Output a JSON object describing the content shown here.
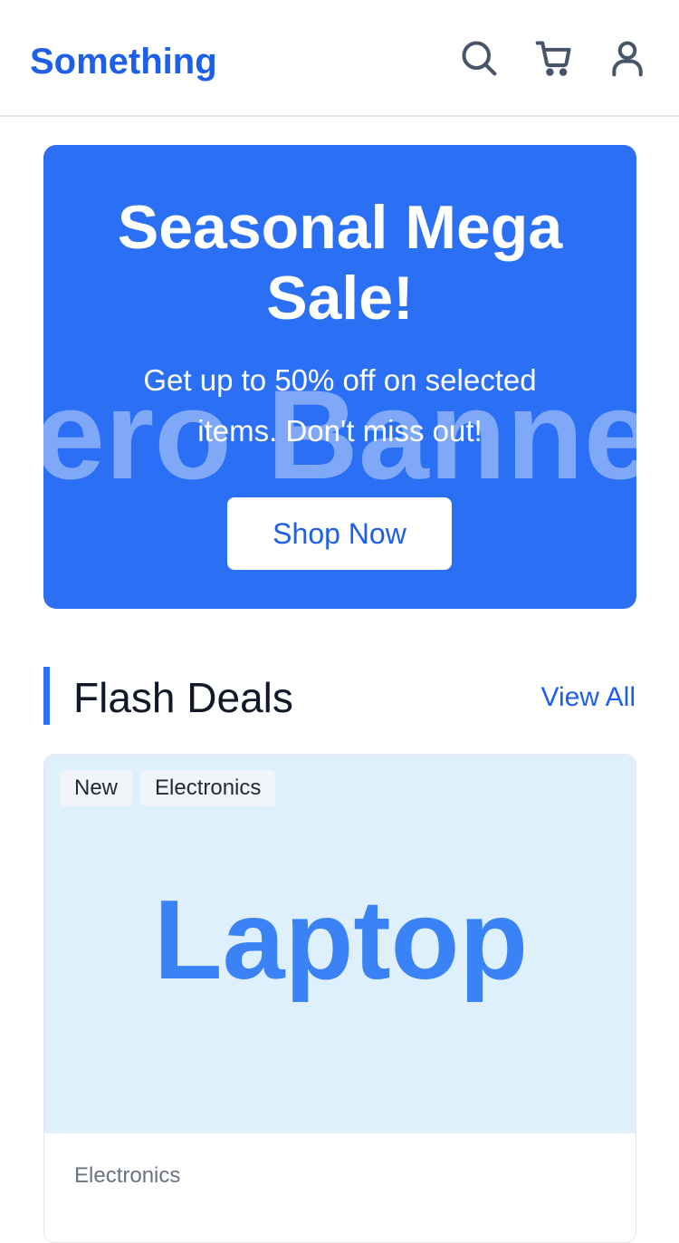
{
  "header": {
    "brand": "Something",
    "icons": [
      "search-icon",
      "cart-icon",
      "user-icon"
    ]
  },
  "hero": {
    "watermark": "ero Banne",
    "title": "Seasonal Mega Sale!",
    "subtitle": "Get up to 50% off on selected items. Don't miss out!",
    "button_label": "Shop Now"
  },
  "flash_deals": {
    "title": "Flash Deals",
    "view_all_label": "View All",
    "products": [
      {
        "tags": [
          "New",
          "Electronics"
        ],
        "image_text": "Laptop",
        "category": "Electronics"
      }
    ]
  },
  "colors": {
    "brand": "#1d5fe8",
    "hero_bg": "#2b6ff5",
    "product_image_bg": "#dff0fd",
    "product_image_text": "#3b82f6"
  }
}
